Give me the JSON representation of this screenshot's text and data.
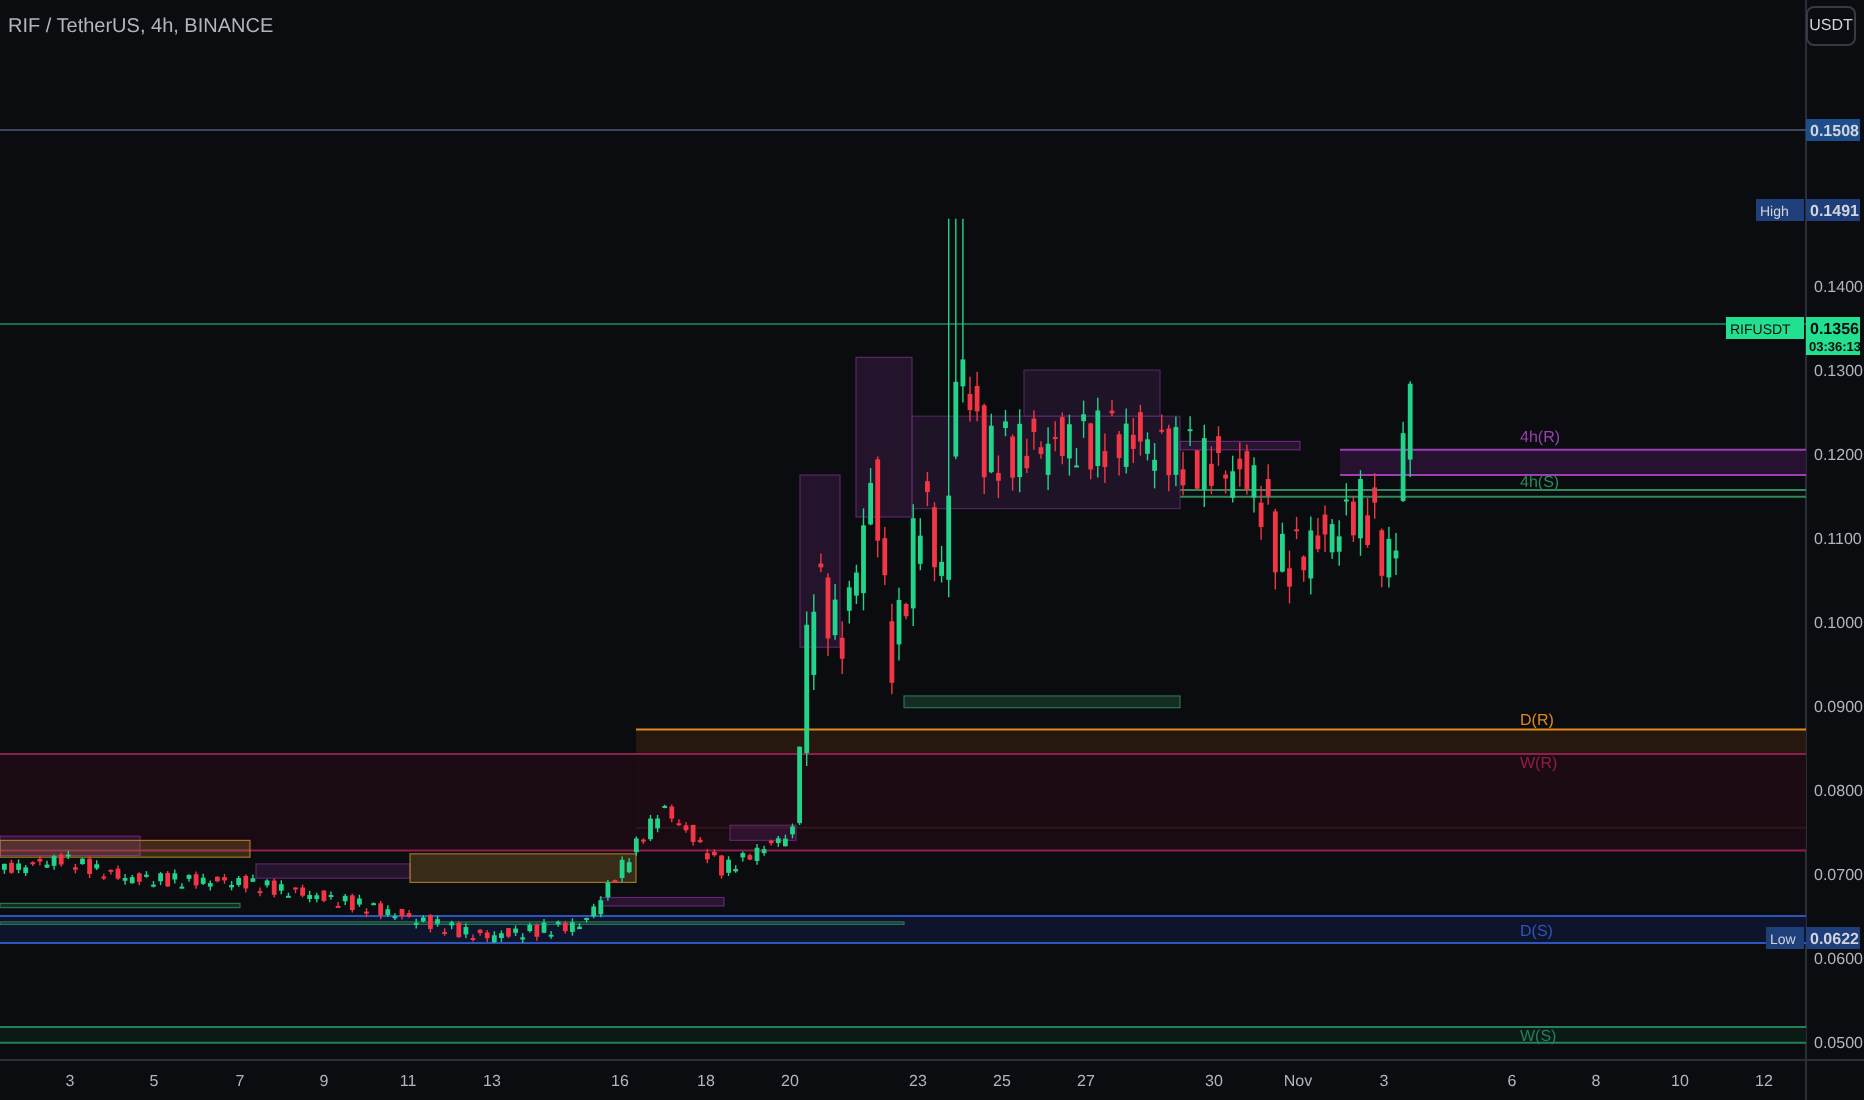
{
  "title": "RIF / TetherUS, 4h, BINANCE",
  "currency_button": "USDT",
  "price_axis": {
    "ticks": [
      "0.1400",
      "0.1300",
      "0.1200",
      "0.1100",
      "0.1000",
      "0.0900",
      "0.0800",
      "0.0700",
      "0.0600",
      "0.0500"
    ]
  },
  "time_axis": {
    "ticks": [
      "3",
      "5",
      "7",
      "9",
      "11",
      "13",
      "16",
      "18",
      "20",
      "23",
      "25",
      "27",
      "30",
      "Nov",
      "3",
      "6",
      "8",
      "10",
      "12"
    ]
  },
  "price_tags": [
    {
      "kind": "level",
      "value": "0.1508"
    },
    {
      "kind": "high",
      "label": "High",
      "value": "0.1491"
    },
    {
      "kind": "last",
      "label": "RIFUSDT",
      "value": "0.1356",
      "countdown": "03:36:13"
    },
    {
      "kind": "low",
      "label": "Low",
      "value": "0.0622"
    }
  ],
  "zones": [
    {
      "label": "4h(R)",
      "color": "#9c3fb0"
    },
    {
      "label": "4h(S)",
      "color": "#2e8a5a"
    },
    {
      "label": "D(R)",
      "color": "#e08a1e"
    },
    {
      "label": "W(R)",
      "color": "#8e1e4a"
    },
    {
      "label": "D(S)",
      "color": "#2f55b8"
    },
    {
      "label": "W(S)",
      "color": "#26805c"
    }
  ]
}
